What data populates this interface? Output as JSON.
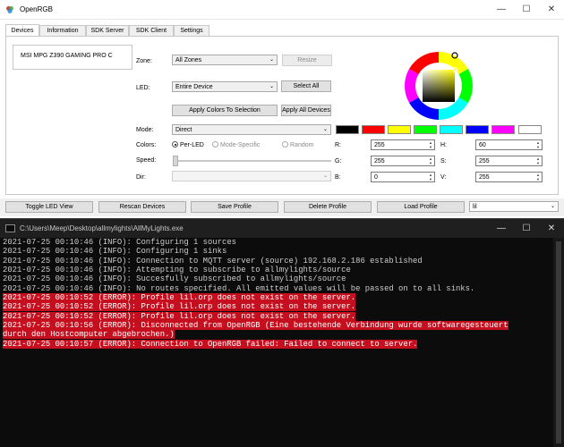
{
  "window": {
    "title": "OpenRGB",
    "minimize": "—",
    "maximize": "☐",
    "close": "✕"
  },
  "tabs": [
    "Devices",
    "Information",
    "SDK Server",
    "SDK Client",
    "Settings"
  ],
  "device_list": [
    "MSI MPG Z390 GAMING PRO C"
  ],
  "zone": {
    "label": "Zone:",
    "value": "All Zones",
    "resize": "Resize"
  },
  "led": {
    "label": "LED:",
    "value": "Entire Device",
    "select_all": "Select All"
  },
  "apply_colors": "Apply Colors To Selection",
  "apply_all_devices": "Apply All Devices",
  "mode": {
    "label": "Mode:",
    "value": "Direct"
  },
  "colors": {
    "label": "Colors:",
    "options": [
      "Per-LED",
      "Mode-Specific",
      "Random"
    ],
    "selected": "Per-LED"
  },
  "speed": {
    "label": "Speed:"
  },
  "dir": {
    "label": "Dir:"
  },
  "swatches": [
    "#000000",
    "#ff0000",
    "#ffff00",
    "#00ff00",
    "#00ffff",
    "#0000ff",
    "#ff00ff",
    "#ffffff"
  ],
  "rgb": {
    "r_label": "R:",
    "r": "255",
    "g_label": "G:",
    "g": "255",
    "b_label": "B:",
    "b": "0"
  },
  "hsv": {
    "h_label": "H:",
    "h": "60",
    "s_label": "S:",
    "s": "255",
    "v_label": "V:",
    "v": "255"
  },
  "bottom": {
    "toggle": "Toggle LED View",
    "rescan": "Rescan Devices",
    "save": "Save Profile",
    "delete": "Delete Profile",
    "load": "Load Profile",
    "profile_value": "lil"
  },
  "console": {
    "title": "C:\\Users\\Meep\\Desktop\\allmylights\\AllMyLights.exe",
    "lines": [
      {
        "text": "2021-07-25 00:10:46 (INFO): Configuring 1 sources",
        "error": false
      },
      {
        "text": "2021-07-25 00:10:46 (INFO): Configuring 1 sinks",
        "error": false
      },
      {
        "text": "2021-07-25 00:10:46 (INFO): Connection to MQTT server (source) 192.168.2.186 established",
        "error": false
      },
      {
        "text": "2021-07-25 00:10:46 (INFO): Attempting to subscribe to allmylights/source",
        "error": false
      },
      {
        "text": "2021-07-25 00:10:46 (INFO): Succesfully subscribed to allmylights/source",
        "error": false
      },
      {
        "text": "2021-07-25 00:10:46 (INFO): No routes specified. All emitted values will be passed on to all sinks.",
        "error": false
      },
      {
        "text": "2021-07-25 00:10:52 (ERROR): Profile lil.orp does not exist on the server.",
        "error": true
      },
      {
        "text": "2021-07-25 00:10:52 (ERROR): Profile lil.orp does not exist on the server.",
        "error": true
      },
      {
        "text": "2021-07-25 00:10:52 (ERROR): Profile lil.orp does not exist on the server.",
        "error": true
      },
      {
        "text": "2021-07-25 00:10:56 (ERROR): Disconnected from OpenRGB (Eine bestehende Verbindung wurde softwaregesteuert",
        "error": true
      },
      {
        "text": "durch den Hostcomputer abgebrochen.)",
        "error": true
      },
      {
        "text": "2021-07-25 00:10:57 (ERROR): Connection to OpenRGB failed: Failed to connect to server.",
        "error": true
      }
    ]
  }
}
